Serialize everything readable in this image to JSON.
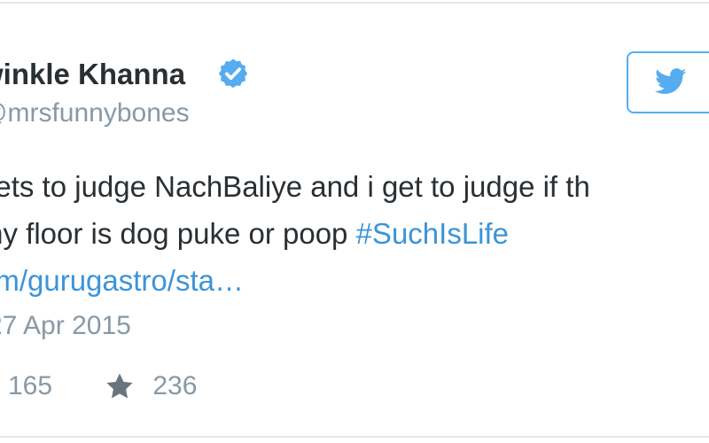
{
  "author": {
    "name": "winkle Khanna",
    "handle": "mrsfunnybones"
  },
  "tweet": {
    "line1": "gets to judge NachBaliye and i get  to judge if th",
    "line2_text": "my floor is dog puke or poop ",
    "hashtag": "#SuchIsLife",
    "link": "om/gurugastro/sta…"
  },
  "meta": {
    "date": "27 Apr 2015"
  },
  "actions": {
    "retweet_count": "165",
    "like_count": "236"
  },
  "icons": {
    "verified": "verified-badge-icon",
    "follow": "twitter-bird-icon",
    "like": "star-icon"
  },
  "colors": {
    "brand": "#55acee",
    "link": "#3b94d9",
    "muted": "#8899a6",
    "text": "#292f33"
  }
}
